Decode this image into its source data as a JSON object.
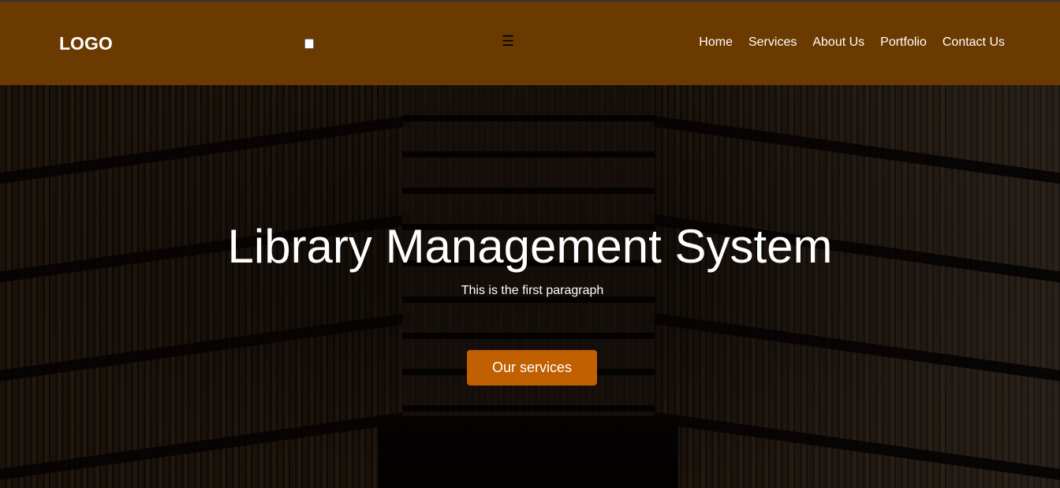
{
  "header": {
    "logo": "LOGO",
    "menu_icon": "☰",
    "nav": [
      {
        "label": "Home"
      },
      {
        "label": "Services"
      },
      {
        "label": "About Us"
      },
      {
        "label": "Portfolio"
      },
      {
        "label": "Contact Us"
      }
    ]
  },
  "hero": {
    "title": "Library Management System",
    "paragraph": "This is the first paragraph",
    "button": "Our services"
  },
  "colors": {
    "header": "#6b3a00",
    "button": "#c06000"
  }
}
